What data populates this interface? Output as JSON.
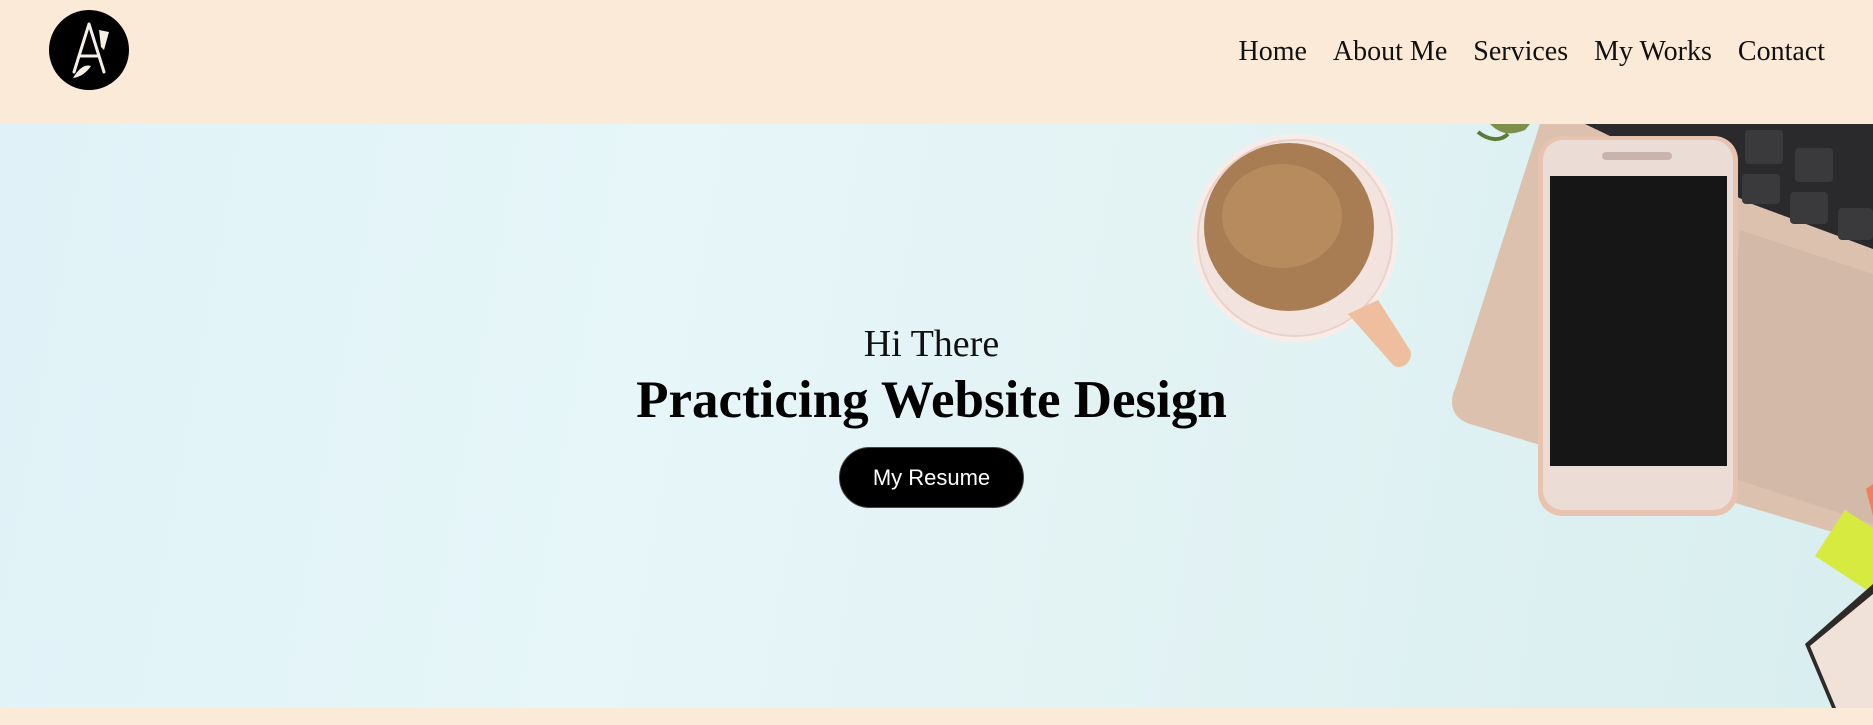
{
  "header": {
    "logo_icon": "pen-letter-a-logo-icon",
    "nav": [
      "Home",
      "About Me",
      "Services",
      "My Works",
      "Contact"
    ]
  },
  "hero": {
    "greeting": "Hi There",
    "headline": "Practicing Website Design",
    "resume_button": "My Resume",
    "background_icon": "desk-coffee-phone-laptop-photo"
  },
  "colors": {
    "header_bg": "#fbead7",
    "hero_bg": "#e2f3f6",
    "button_bg": "#000000",
    "button_text": "#ffffff"
  }
}
